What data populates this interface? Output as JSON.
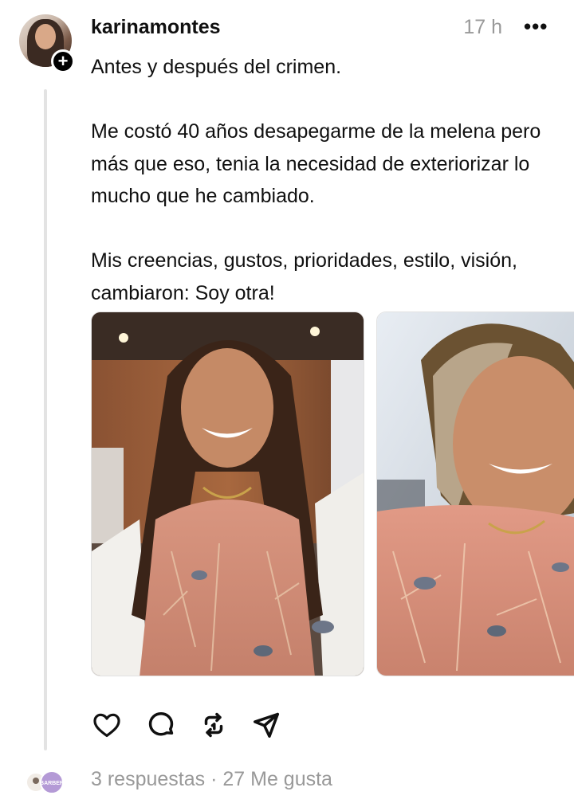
{
  "post": {
    "username": "karinamontes",
    "time": "17 h",
    "more_label": "•••",
    "follow_label": "+",
    "paragraphs": [
      "Antes y después del crimen.",
      "Me costó 40 años desapegarme de la melena pero más que eso, tenia la necesidad de exteriorizar lo mucho que he cambiado.",
      "Mis creencias, gustos, prioridades, estilo, visión, cambiaron: Soy otra!"
    ],
    "photos": [
      {
        "alt": "before-photo"
      },
      {
        "alt": "after-photo"
      }
    ]
  },
  "actions": {
    "icons": [
      "heart-icon",
      "comment-icon",
      "repost-icon",
      "share-icon"
    ]
  },
  "footer": {
    "replies": "3 respuestas",
    "separator": "·",
    "likes": "27 Me gusta",
    "reply_avatar_text": "BARBER"
  },
  "colors": {
    "text": "#101010",
    "muted": "#999999",
    "thread_line": "#e3e3e3"
  }
}
